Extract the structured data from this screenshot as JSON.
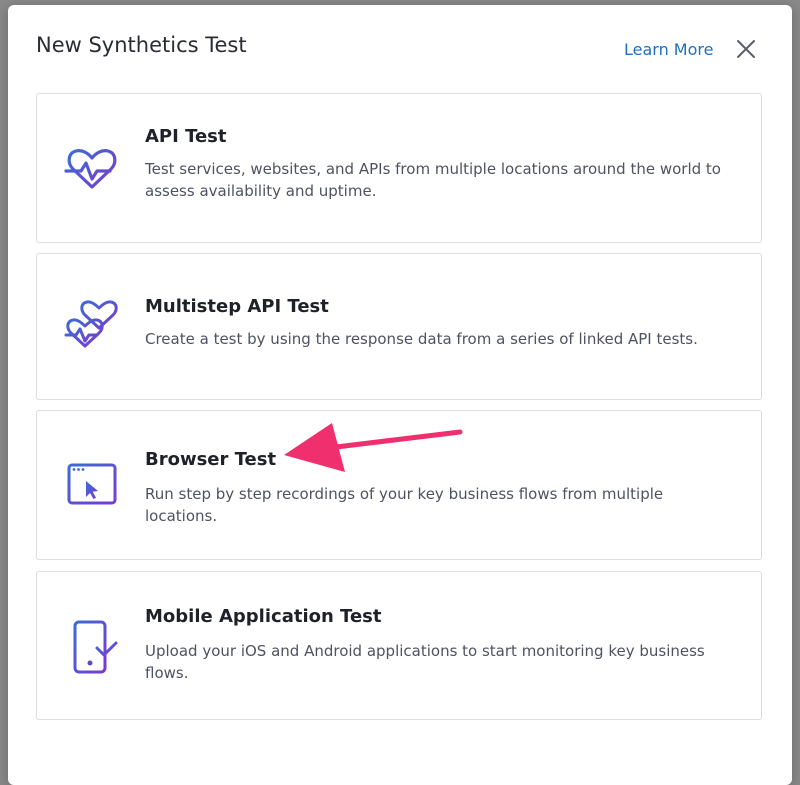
{
  "dialog": {
    "title": "New Synthetics Test",
    "learn_more": "Learn More",
    "close_icon": "close-icon"
  },
  "options": [
    {
      "title": "API Test",
      "description": "Test services, websites, and APIs from multiple locations around the world to assess availability and uptime.",
      "icon": "heart-pulse-icon"
    },
    {
      "title": "Multistep API Test",
      "description": "Create a test by using the response data from a series of linked API tests.",
      "icon": "double-heart-pulse-icon"
    },
    {
      "title": "Browser Test",
      "description": "Run step by step recordings of your key business flows from multiple locations.",
      "icon": "browser-window-cursor-icon"
    },
    {
      "title": "Mobile Application Test",
      "description": "Upload your iOS and Android applications to start monitoring key business flows.",
      "icon": "mobile-phone-icon"
    }
  ],
  "annotation": {
    "icon": "pink-arrow-icon",
    "color": "#f0306e"
  },
  "colors": {
    "accent": "#5a47c9",
    "link": "#1f70c1",
    "overlay": "#8a8a8a"
  }
}
